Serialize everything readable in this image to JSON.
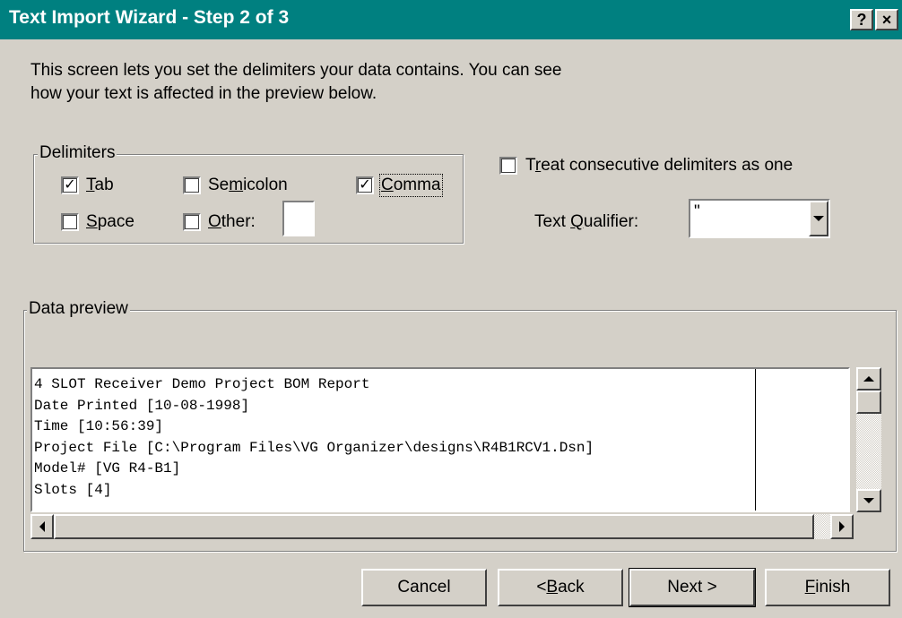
{
  "window": {
    "title": "Text Import Wizard - Step 2 of 3",
    "help_button": "?",
    "close_button": "×"
  },
  "intro": {
    "line1": "This screen lets you set the delimiters your data contains.  You can see",
    "line2": "how your text is affected in the preview below."
  },
  "delimiters": {
    "legend": "Delimiters",
    "tab": {
      "pre": "",
      "accel": "T",
      "post": "ab",
      "checked": true
    },
    "semicolon": {
      "pre": "Se",
      "accel": "m",
      "post": "icolon",
      "checked": false
    },
    "comma": {
      "pre": "",
      "accel": "C",
      "post": "omma",
      "checked": true
    },
    "space": {
      "pre": "",
      "accel": "S",
      "post": "pace",
      "checked": false
    },
    "other": {
      "pre": "",
      "accel": "O",
      "post": "ther:",
      "checked": false,
      "value": ""
    }
  },
  "consecutive": {
    "pre": "T",
    "accel": "r",
    "post": "eat consecutive delimiters as one",
    "checked": false
  },
  "text_qualifier": {
    "label_pre": "Text ",
    "label_accel": "Q",
    "label_post": "ualifier:",
    "value": "\""
  },
  "preview": {
    "legend": "Data preview",
    "lines": [
      "4 SLOT Receiver Demo Project BOM Report",
      "Date Printed [10-08-1998]",
      "Time [10:56:39]",
      "Project File [C:\\Program Files\\VG Organizer\\designs\\R4B1RCV1.Dsn]",
      "Model# [VG R4-B1]",
      "Slots [4]"
    ]
  },
  "buttons": {
    "cancel": "Cancel",
    "back": {
      "pre": "< ",
      "accel": "B",
      "post": "ack"
    },
    "next": "Next >",
    "finish": {
      "pre": "",
      "accel": "F",
      "post": "inish"
    }
  },
  "colors": {
    "titlebar": "#008080",
    "face": "#d4d0c8"
  },
  "icons": [
    "help-icon",
    "close-icon",
    "check-icon",
    "scroll-up-icon",
    "scroll-down-icon",
    "scroll-left-icon",
    "scroll-right-icon",
    "dropdown-arrow-icon"
  ]
}
